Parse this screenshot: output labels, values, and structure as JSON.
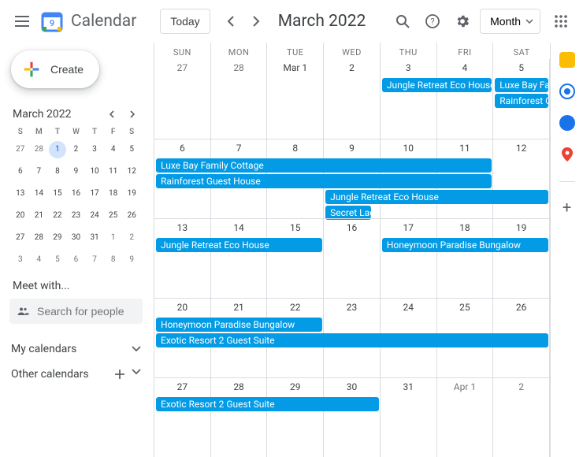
{
  "header": {
    "app_title": "Calendar",
    "today_label": "Today",
    "month_title": "March 2022",
    "view_label": "Month"
  },
  "sidebar": {
    "create_label": "Create",
    "mini_title": "March 2022",
    "mini_dow": [
      "S",
      "M",
      "T",
      "W",
      "T",
      "F",
      "S"
    ],
    "mini_days": [
      {
        "n": "27",
        "muted": true
      },
      {
        "n": "28",
        "muted": true
      },
      {
        "n": "1",
        "today": true
      },
      {
        "n": "2"
      },
      {
        "n": "3"
      },
      {
        "n": "4"
      },
      {
        "n": "5"
      },
      {
        "n": "6"
      },
      {
        "n": "7"
      },
      {
        "n": "8"
      },
      {
        "n": "9"
      },
      {
        "n": "10"
      },
      {
        "n": "11"
      },
      {
        "n": "12"
      },
      {
        "n": "13"
      },
      {
        "n": "14"
      },
      {
        "n": "15"
      },
      {
        "n": "16"
      },
      {
        "n": "17"
      },
      {
        "n": "18"
      },
      {
        "n": "19"
      },
      {
        "n": "20"
      },
      {
        "n": "21"
      },
      {
        "n": "22"
      },
      {
        "n": "23"
      },
      {
        "n": "24"
      },
      {
        "n": "25"
      },
      {
        "n": "26"
      },
      {
        "n": "27"
      },
      {
        "n": "28"
      },
      {
        "n": "29"
      },
      {
        "n": "30"
      },
      {
        "n": "31"
      },
      {
        "n": "1",
        "muted": true
      },
      {
        "n": "2",
        "muted": true
      },
      {
        "n": "3",
        "muted": true
      },
      {
        "n": "4",
        "muted": true
      },
      {
        "n": "5",
        "muted": true
      },
      {
        "n": "6",
        "muted": true
      },
      {
        "n": "7",
        "muted": true
      },
      {
        "n": "8",
        "muted": true
      },
      {
        "n": "9",
        "muted": true
      }
    ],
    "meet_label": "Meet with...",
    "search_placeholder": "Search for people",
    "my_calendars_label": "My calendars",
    "other_calendars_label": "Other calendars"
  },
  "calendar": {
    "dow": [
      "SUN",
      "MON",
      "TUE",
      "WED",
      "THU",
      "FRI",
      "SAT"
    ],
    "weeks": [
      [
        {
          "n": "27",
          "muted": true
        },
        {
          "n": "28",
          "muted": true
        },
        {
          "n": "Mar 1",
          "first": true
        },
        {
          "n": "2"
        },
        {
          "n": "3"
        },
        {
          "n": "4"
        },
        {
          "n": "5"
        }
      ],
      [
        {
          "n": "6"
        },
        {
          "n": "7"
        },
        {
          "n": "8"
        },
        {
          "n": "9"
        },
        {
          "n": "10"
        },
        {
          "n": "11"
        },
        {
          "n": "12"
        }
      ],
      [
        {
          "n": "13"
        },
        {
          "n": "14"
        },
        {
          "n": "15"
        },
        {
          "n": "16"
        },
        {
          "n": "17"
        },
        {
          "n": "18"
        },
        {
          "n": "19"
        }
      ],
      [
        {
          "n": "20"
        },
        {
          "n": "21"
        },
        {
          "n": "22"
        },
        {
          "n": "23"
        },
        {
          "n": "24"
        },
        {
          "n": "25"
        },
        {
          "n": "26"
        }
      ],
      [
        {
          "n": "27"
        },
        {
          "n": "28"
        },
        {
          "n": "29"
        },
        {
          "n": "30"
        },
        {
          "n": "31"
        },
        {
          "n": "Apr 1",
          "first": true,
          "muted": true
        },
        {
          "n": "2",
          "muted": true
        }
      ]
    ],
    "events": [
      {
        "week": 0,
        "row": 0,
        "startCol": 4,
        "span": 2,
        "label": "Jungle Retreat Eco House"
      },
      {
        "week": 0,
        "row": 0,
        "startCol": 6,
        "span": 1,
        "label": "Luxe Bay Family Cottage",
        "truncate": "Luxe Bay Far"
      },
      {
        "week": 0,
        "row": 1,
        "startCol": 6,
        "span": 1,
        "label": "Rainforest Guest House",
        "truncate": "Rainforest G"
      },
      {
        "week": 1,
        "row": 0,
        "startCol": 0,
        "span": 6,
        "label": "Luxe Bay Family Cottage"
      },
      {
        "week": 1,
        "row": 1,
        "startCol": 0,
        "span": 6,
        "label": "Rainforest Guest House"
      },
      {
        "week": 1,
        "row": 2,
        "startCol": 3,
        "span": 4,
        "label": "Jungle Retreat Eco House"
      },
      {
        "week": 1,
        "row": 3,
        "startCol": 3,
        "span": 1,
        "label": "Secret Lagoon",
        "truncate": "Secret Lagoo",
        "narrow": true
      },
      {
        "week": 2,
        "row": 0,
        "startCol": 0,
        "span": 3,
        "label": "Jungle Retreat Eco House"
      },
      {
        "week": 2,
        "row": 0,
        "startCol": 4,
        "span": 3,
        "label": "Honeymoon Paradise Bungalow"
      },
      {
        "week": 3,
        "row": 0,
        "startCol": 0,
        "span": 3,
        "label": "Honeymoon Paradise Bungalow"
      },
      {
        "week": 3,
        "row": 1,
        "startCol": 0,
        "span": 7,
        "label": "Exotic Resort 2 Guest Suite"
      },
      {
        "week": 4,
        "row": 0,
        "startCol": 0,
        "span": 4,
        "label": "Exotic Resort 2 Guest Suite"
      }
    ]
  },
  "colors": {
    "event_bg": "#039be5"
  }
}
